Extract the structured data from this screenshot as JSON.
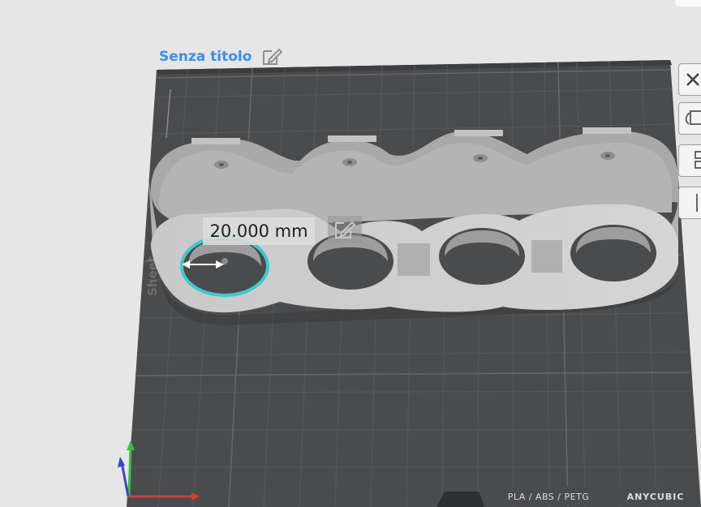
{
  "project": {
    "title": "Senza titolo"
  },
  "measurement": {
    "value_label": "20.000 mm"
  },
  "bed": {
    "side_label": "Sheet",
    "filament_label": "PLA / ABS / PETG",
    "brand_label": "ANYCUBIC"
  },
  "icons": {
    "edit_title": "pencil-square-icon",
    "edit_measurement": "pencil-square-icon",
    "axes": "xyz-axes-icon"
  },
  "colors": {
    "title": "#3c8ef2",
    "bed": "#4a4b4d",
    "model": "#b8b8b8",
    "highlight": "#3ec9cf",
    "background": "#e6e6e6"
  }
}
